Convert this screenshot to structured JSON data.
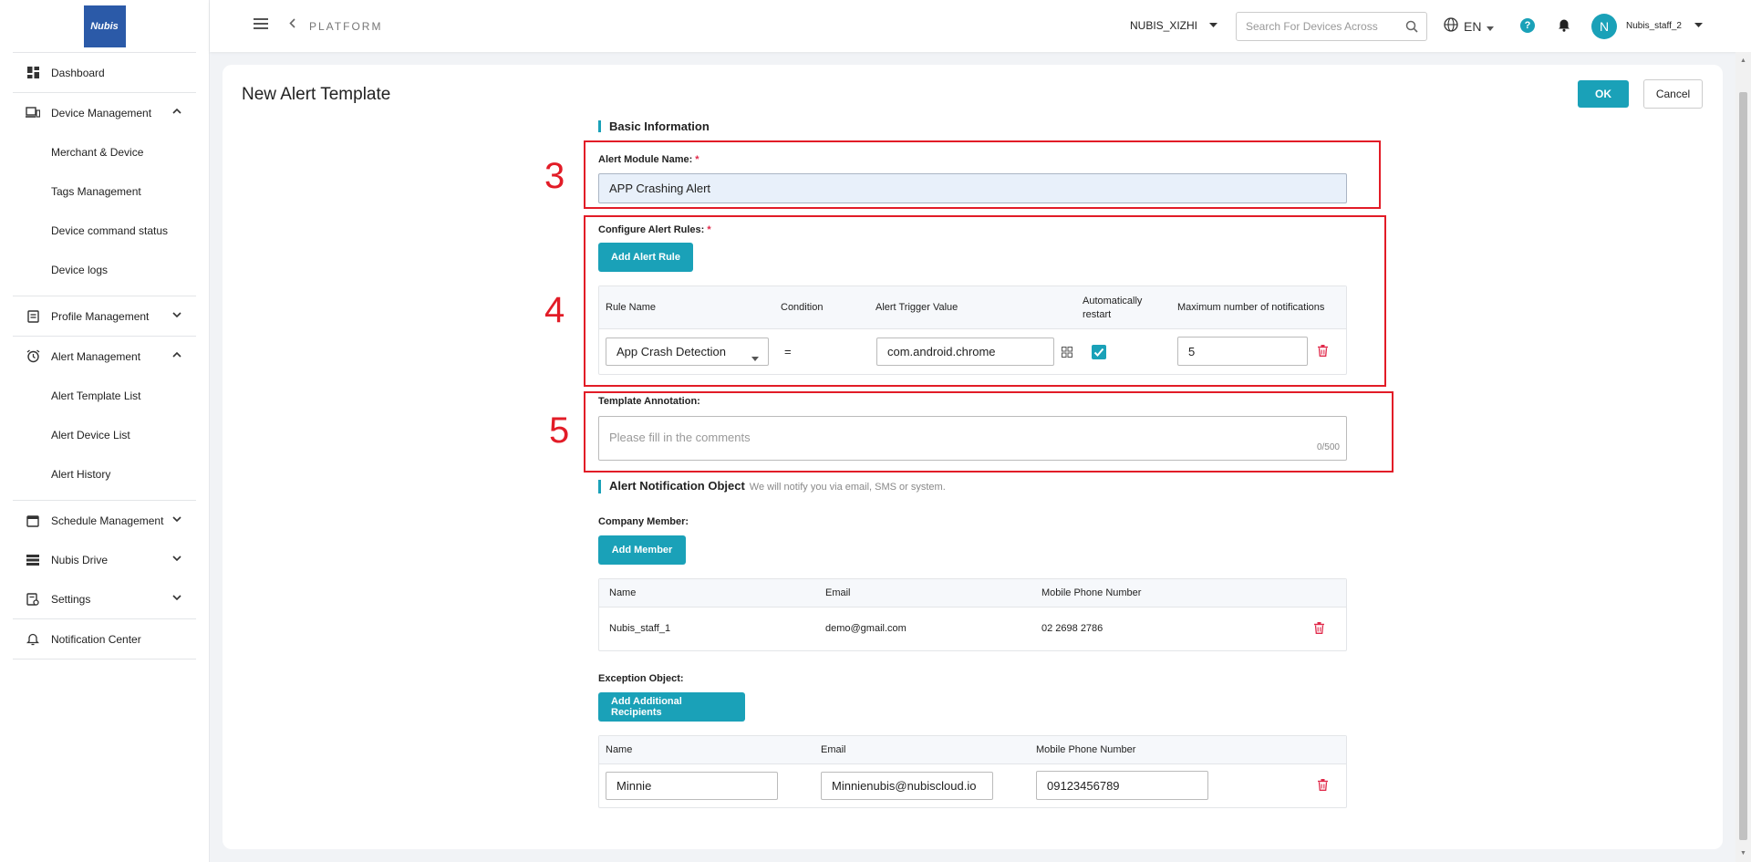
{
  "brand": {
    "logo_text": "Nubis",
    "accent": "#1aa1b8",
    "danger": "#e0294a",
    "annotation_red": "#e21c27"
  },
  "sidebar": {
    "dashboard": "Dashboard",
    "device_management": "Device Management",
    "device_sub": [
      "Merchant & Device",
      "Tags Management",
      "Device command status",
      "Device logs"
    ],
    "profile_management": "Profile Management",
    "alert_management": "Alert Management",
    "alert_sub": [
      "Alert Template List",
      "Alert Device List",
      "Alert History"
    ],
    "schedule_management": "Schedule Management",
    "nubis_drive": "Nubis Drive",
    "settings": "Settings",
    "notification_center": "Notification Center"
  },
  "header": {
    "breadcrumb": "PLATFORM",
    "org": "NUBIS_XIZHI",
    "search_placeholder": "Search For Devices Across",
    "lang": "EN",
    "help": "?",
    "avatar": "N",
    "user": "Nubis_staff_2"
  },
  "page": {
    "title": "New Alert Template",
    "ok": "OK",
    "cancel": "Cancel"
  },
  "basic": {
    "title": "Basic Information",
    "module_label": "Alert Module Name:",
    "module_value": "APP Crashing Alert",
    "rules_label": "Configure Alert Rules:",
    "add_rule": "Add Alert Rule",
    "rule_cols": [
      "Rule Name",
      "Condition",
      "Alert Trigger Value",
      "Automatically restart",
      "Maximum number of notifications"
    ],
    "rule": {
      "name": "App Crash Detection",
      "condition": "=",
      "trigger": "com.android.chrome",
      "auto_restart": true,
      "max": "5"
    },
    "annotation_label": "Template Annotation:",
    "annotation_placeholder": "Please fill in the comments",
    "annotation_counter": "0/500"
  },
  "annotations": {
    "box3": "3",
    "box4": "4",
    "box5": "5"
  },
  "notification": {
    "title": "Alert Notification Object",
    "subtitle": "We will notify you via email, SMS or system.",
    "company_label": "Company Member:",
    "add_member": "Add Member",
    "cols": [
      "Name",
      "Email",
      "Mobile Phone Number"
    ],
    "member": {
      "name": "Nubis_staff_1",
      "email": "demo@gmail.com",
      "phone": "02 2698 2786"
    },
    "exception_label": "Exception Object:",
    "add_recipients": "Add Additional Recipients",
    "recipient": {
      "name": "Minnie",
      "email": "Minnienubis@nubiscloud.io",
      "phone": "09123456789"
    }
  }
}
